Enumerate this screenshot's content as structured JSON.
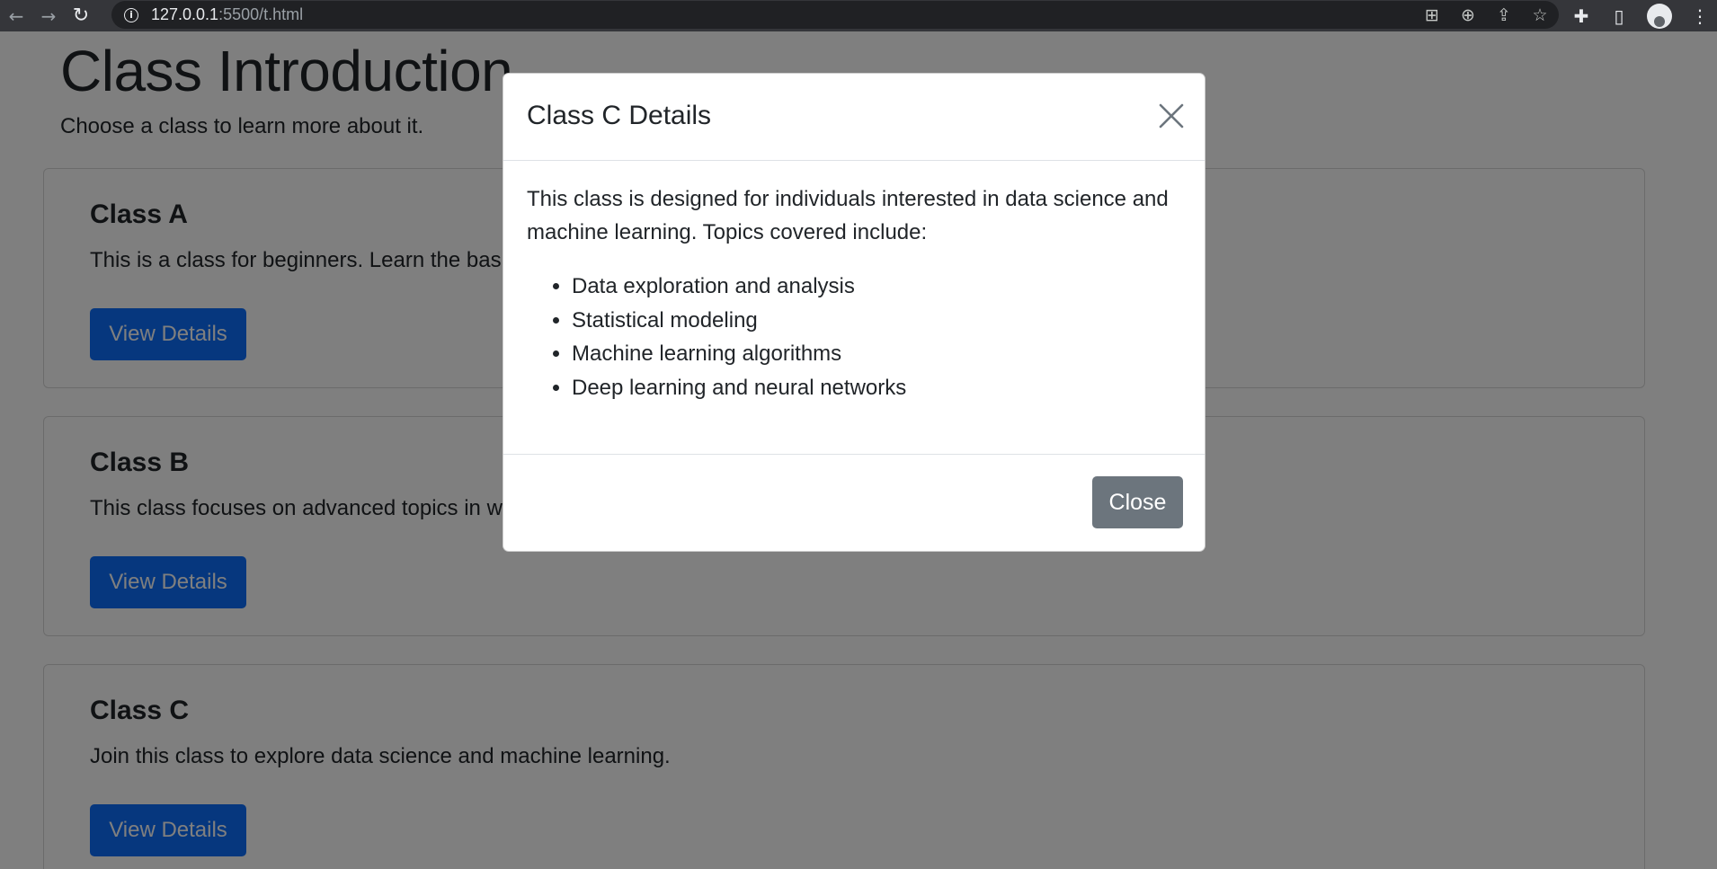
{
  "browser": {
    "url_host": "127.0.0.1",
    "url_rest": ":5500/t.html"
  },
  "page": {
    "title": "Class Introduction",
    "subtitle": "Choose a class to learn more about it.",
    "cards": [
      {
        "title": "Class A",
        "text": "This is a class for beginners. Learn the basics of programming.",
        "button": "View Details"
      },
      {
        "title": "Class B",
        "text": "This class focuses on advanced topics in web development.",
        "button": "View Details"
      },
      {
        "title": "Class C",
        "text": "Join this class to explore data science and machine learning.",
        "button": "View Details"
      }
    ]
  },
  "modal": {
    "title": "Class C Details",
    "description": "This class is designed for individuals interested in data science and machine learning. Topics covered include:",
    "topics": [
      "Data exploration and analysis",
      "Statistical modeling",
      "Machine learning algorithms",
      "Deep learning and neural networks"
    ],
    "close_label": "Close"
  },
  "colors": {
    "primary_button": "#0d6efd",
    "secondary_button": "#6c757d",
    "backdrop": "rgba(0,0,0,0.5)"
  }
}
